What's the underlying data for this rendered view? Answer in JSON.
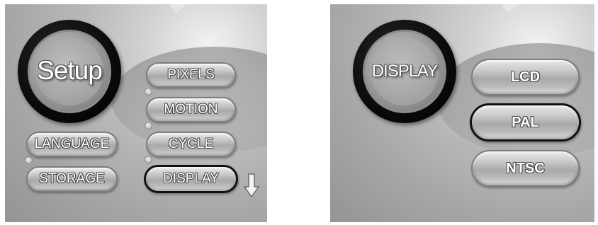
{
  "left_screen": {
    "title": "Setup",
    "right_menu": [
      "PIXELS",
      "MOTION",
      "CYCLE",
      "DISPLAY"
    ],
    "left_menu": [
      "LANGUAGE",
      "STORAGE"
    ],
    "selected": "DISPLAY",
    "scroll_icon": "down-arrow-icon"
  },
  "right_screen": {
    "title": "DISPLAY",
    "options": [
      "LCD",
      "PAL",
      "NTSC"
    ],
    "selected": "PAL"
  },
  "colors": {
    "selection_border": "#111111",
    "label_text": "#ffffff"
  }
}
